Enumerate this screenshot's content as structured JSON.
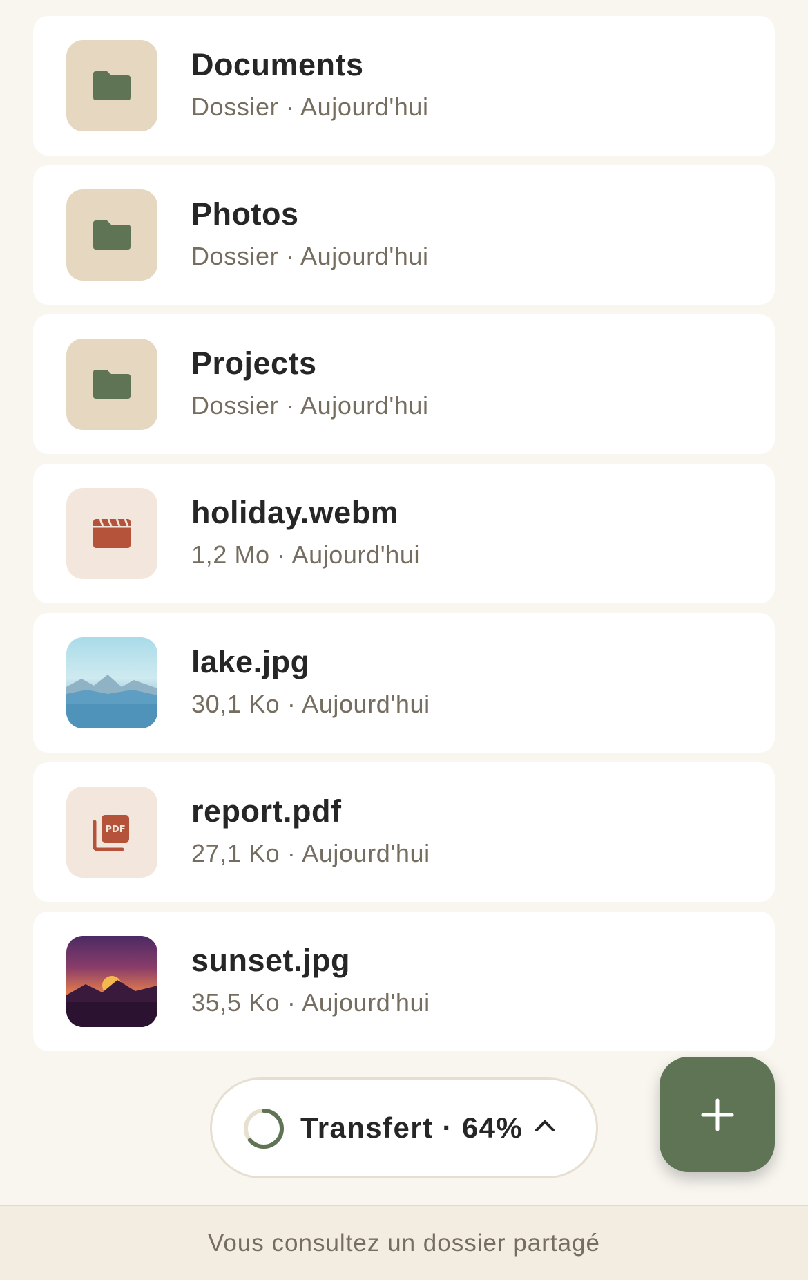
{
  "files": [
    {
      "name": "Documents",
      "meta": "Dossier · Aujourd'hui",
      "kind": "folder",
      "icon": "folder-icon"
    },
    {
      "name": "Photos",
      "meta": "Dossier · Aujourd'hui",
      "kind": "folder",
      "icon": "folder-icon"
    },
    {
      "name": "Projects",
      "meta": "Dossier · Aujourd'hui",
      "kind": "folder",
      "icon": "folder-icon"
    },
    {
      "name": "holiday.webm",
      "meta": "1,2 Mo · Aujourd'hui",
      "kind": "video",
      "icon": "video-clapper-icon"
    },
    {
      "name": "lake.jpg",
      "meta": "30,1 Ko · Aujourd'hui",
      "kind": "image",
      "icon": "lake-thumbnail"
    },
    {
      "name": "report.pdf",
      "meta": "27,1 Ko · Aujourd'hui",
      "kind": "pdf",
      "icon": "pdf-icon"
    },
    {
      "name": "sunset.jpg",
      "meta": "35,5 Ko · Aujourd'hui",
      "kind": "image",
      "icon": "sunset-thumbnail"
    }
  ],
  "transfer": {
    "label": "Transfert · 64%",
    "progress": 0.64,
    "expand_icon": "chevron-up-icon"
  },
  "fab": {
    "icon": "plus-icon"
  },
  "footer": {
    "text": "Vous consultez un dossier partagé"
  },
  "colors": {
    "background": "#f9f6f0",
    "card": "#ffffff",
    "accent_green": "#5e7454",
    "folder_tile": "#e5d7c0",
    "doc_tile": "#f3e7dd",
    "doc_icon_red": "#b5533a",
    "text_primary": "#262626",
    "text_secondary": "#756d5f"
  }
}
